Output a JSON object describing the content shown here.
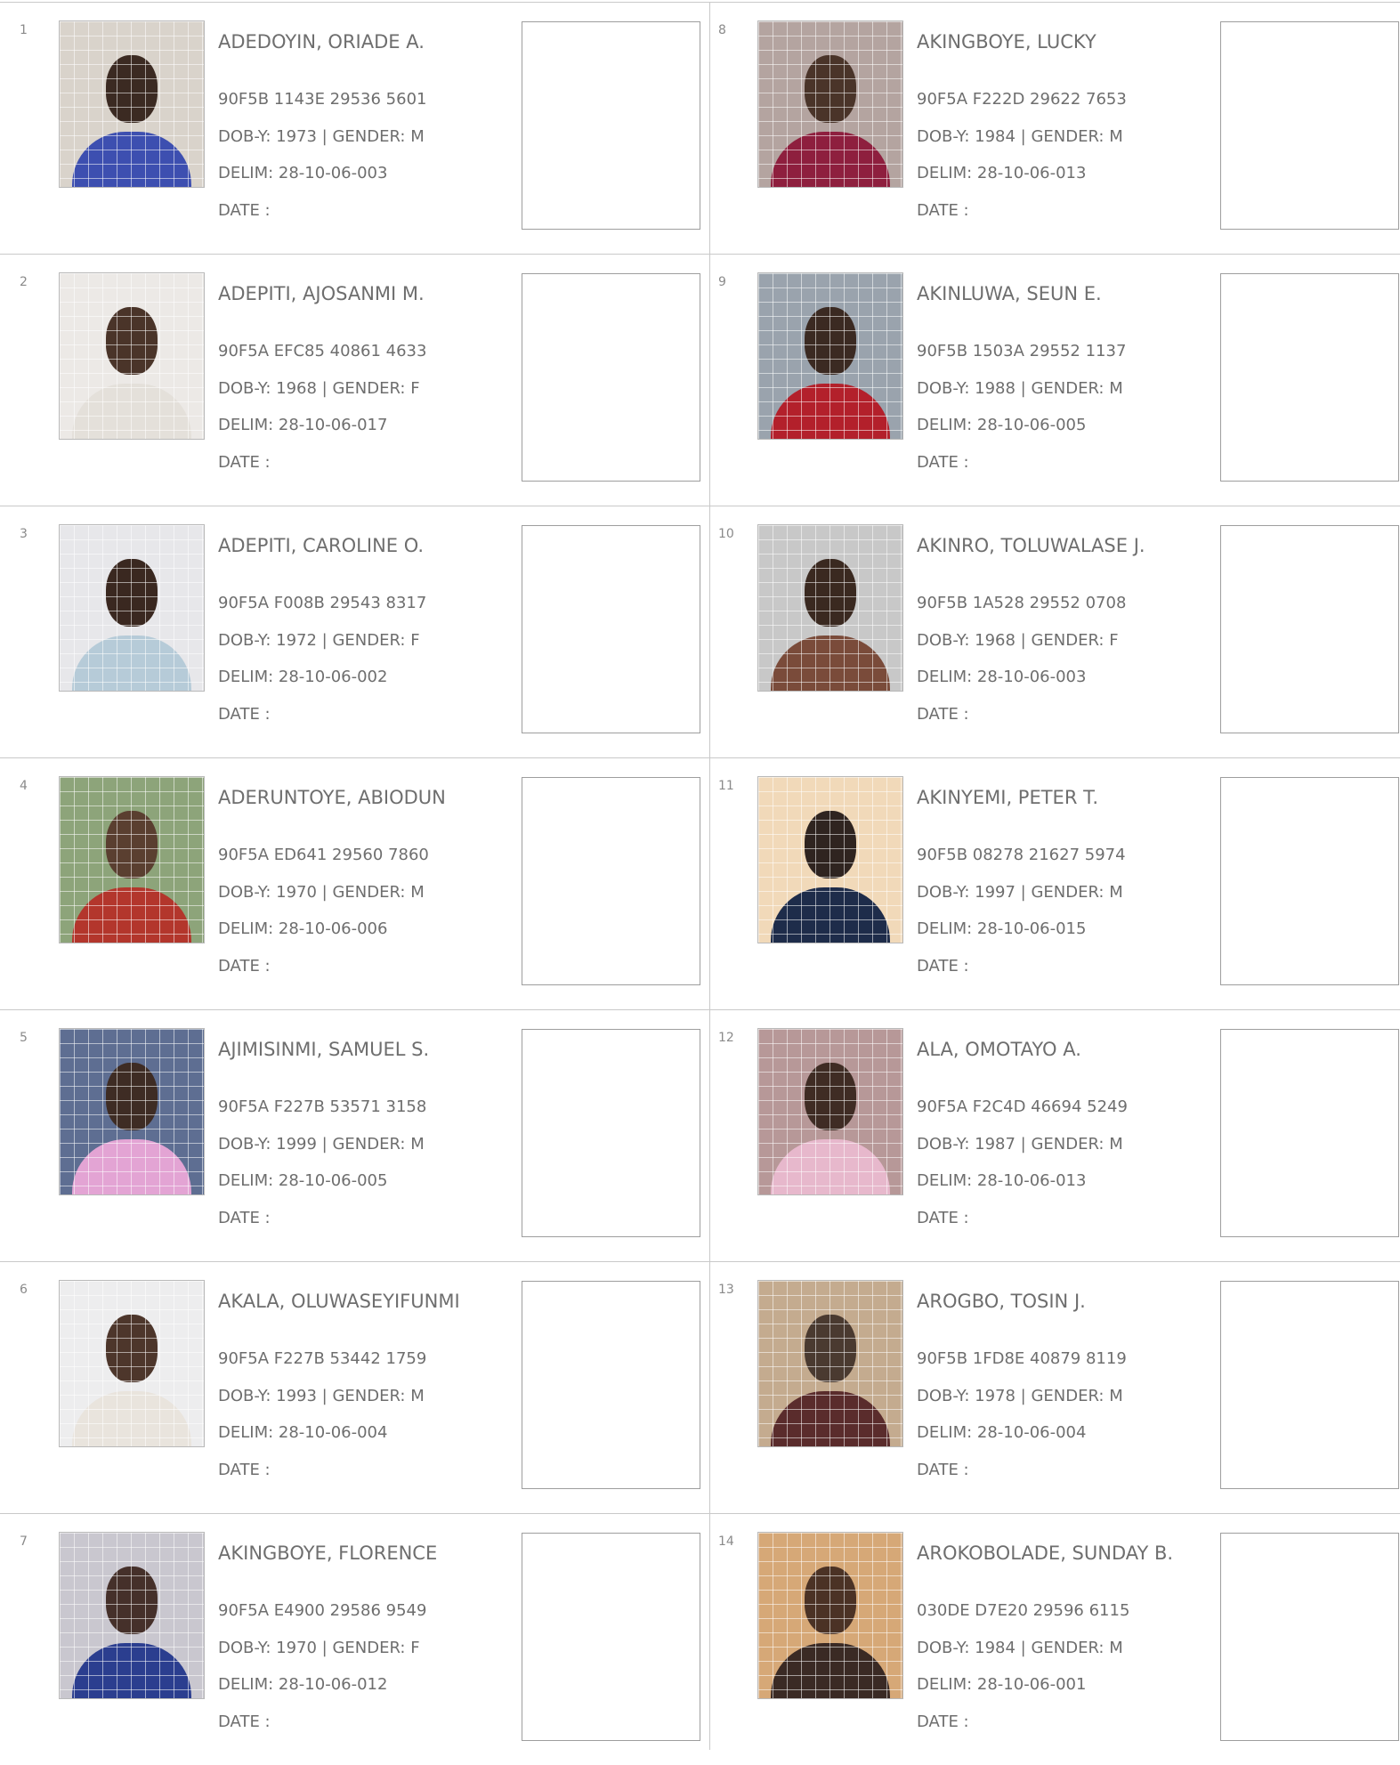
{
  "labels": {
    "dob_prefix": "DOB-Y: ",
    "gender_prefix": " | GENDER: ",
    "delim_prefix": "DELIM: ",
    "date_label": "DATE :"
  },
  "records": [
    {
      "index": "1",
      "name": "ADEDOYIN, ORIADE A.",
      "id": "90F5B 1143E 29536 5601",
      "dob": "1973",
      "gender": "M",
      "delim": "28-10-06-003",
      "photo": {
        "bg": "#d9d3cb",
        "skin": "#3b2a22",
        "cloth": "#3d4fb0"
      }
    },
    {
      "index": "2",
      "name": "ADEPITI, AJOSANMI M.",
      "id": "90F5A EFC85 40861 4633",
      "dob": "1968",
      "gender": "F",
      "delim": "28-10-06-017",
      "photo": {
        "bg": "#ece9e6",
        "skin": "#4a3429",
        "cloth": "#e4e0da"
      }
    },
    {
      "index": "3",
      "name": "ADEPITI, CAROLINE O.",
      "id": "90F5A F008B 29543 8317",
      "dob": "1972",
      "gender": "F",
      "delim": "28-10-06-002",
      "photo": {
        "bg": "#e7e7ea",
        "skin": "#3a2820",
        "cloth": "#b6cbd8"
      }
    },
    {
      "index": "4",
      "name": "ADERUNTOYE, ABIODUN",
      "id": "90F5A ED641 29560 7860",
      "dob": "1970",
      "gender": "M",
      "delim": "28-10-06-006",
      "photo": {
        "bg": "#8da47a",
        "skin": "#5a3f30",
        "cloth": "#b3362c"
      }
    },
    {
      "index": "5",
      "name": "AJIMISINMI, SAMUEL S.",
      "id": "90F5A F227B 53571 3158",
      "dob": "1999",
      "gender": "M",
      "delim": "28-10-06-005",
      "photo": {
        "bg": "#5e6e92",
        "skin": "#3e2c24",
        "cloth": "#e3a4d4"
      }
    },
    {
      "index": "6",
      "name": "AKALA, OLUWASEYIFUNMI",
      "id": "90F5A F227B 53442 1759",
      "dob": "1993",
      "gender": "M",
      "delim": "28-10-06-004",
      "photo": {
        "bg": "#ededee",
        "skin": "#4d362b",
        "cloth": "#e9e4dd"
      }
    },
    {
      "index": "7",
      "name": "AKINGBOYE, FLORENCE",
      "id": "90F5A E4900 29586 9549",
      "dob": "1970",
      "gender": "F",
      "delim": "28-10-06-012",
      "photo": {
        "bg": "#c9c7cf",
        "skin": "#45302a",
        "cloth": "#2b3e8f"
      }
    },
    {
      "index": "8",
      "name": "AKINGBOYE, LUCKY",
      "id": "90F5A F222D 29622 7653",
      "dob": "1984",
      "gender": "M",
      "delim": "28-10-06-013",
      "photo": {
        "bg": "#b4a4a0",
        "skin": "#4a3429",
        "cloth": "#8e1f3e"
      }
    },
    {
      "index": "9",
      "name": "AKINLUWA, SEUN E.",
      "id": "90F5B 1503A 29552 1137",
      "dob": "1988",
      "gender": "M",
      "delim": "28-10-06-005",
      "photo": {
        "bg": "#9aa3ad",
        "skin": "#3b2a22",
        "cloth": "#b3202b"
      }
    },
    {
      "index": "10",
      "name": "AKINRO, TOLUWALASE J.",
      "id": "90F5B 1A528 29552 0708",
      "dob": "1968",
      "gender": "F",
      "delim": "28-10-06-003",
      "photo": {
        "bg": "#c8c8c8",
        "skin": "#3a2920",
        "cloth": "#7a4b3a"
      }
    },
    {
      "index": "11",
      "name": "AKINYEMI, PETER T.",
      "id": "90F5B 08278 21627 5974",
      "dob": "1997",
      "gender": "M",
      "delim": "28-10-06-015",
      "photo": {
        "bg": "#f1d9b9",
        "skin": "#2f2420",
        "cloth": "#1e2c4a"
      }
    },
    {
      "index": "12",
      "name": "ALA, OMOTAYO A.",
      "id": "90F5A F2C4D 46694 5249",
      "dob": "1987",
      "gender": "M",
      "delim": "28-10-06-013",
      "photo": {
        "bg": "#b79898",
        "skin": "#3f2c24",
        "cloth": "#e7b8cc"
      }
    },
    {
      "index": "13",
      "name": "AROGBO, TOSIN J.",
      "id": "90F5B 1FD8E 40879 8119",
      "dob": "1978",
      "gender": "M",
      "delim": "28-10-06-004",
      "photo": {
        "bg": "#c4ab8f",
        "skin": "#4a3a30",
        "cloth": "#5a2c2c"
      }
    },
    {
      "index": "14",
      "name": "AROKOBOLADE, SUNDAY B.",
      "id": "030DE D7E20 29596 6115",
      "dob": "1984",
      "gender": "M",
      "delim": "28-10-06-001",
      "photo": {
        "bg": "#d6a877",
        "skin": "#4b3225",
        "cloth": "#3a2a24"
      }
    }
  ]
}
